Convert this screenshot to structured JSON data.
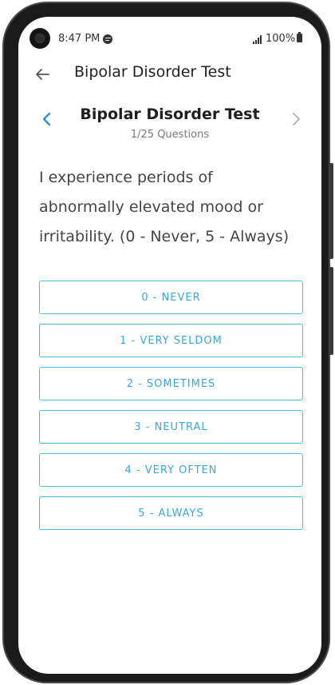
{
  "status_bar": {
    "time": "8:47 PM",
    "battery": "100%",
    "music_app_icon": "spotify-icon",
    "signal_icon": "signal-icon",
    "battery_icon": "battery-icon"
  },
  "app_bar": {
    "title": "Bipolar Disorder Test",
    "back_icon": "arrow-left-icon"
  },
  "quiz": {
    "title": "Bipolar Disorder Test",
    "progress": "1/25 Questions",
    "question": "I experience periods of abnormally elevated mood or irritability. (0 - Never, 5 - Always)",
    "prev_icon": "chevron-left-icon",
    "next_icon": "chevron-right-icon",
    "options": [
      {
        "label": "0 - NEVER"
      },
      {
        "label": "1 - VERY SELDOM"
      },
      {
        "label": "2 - SOMETIMES"
      },
      {
        "label": "3 - NEUTRAL"
      },
      {
        "label": "4 - VERY OFTEN"
      },
      {
        "label": "5 - ALWAYS"
      }
    ]
  },
  "colors": {
    "accent": "#3aa7d6",
    "option_border": "#4db8e0",
    "prev_chevron": "#2f8fd8",
    "next_chevron": "#aaaaaa"
  }
}
